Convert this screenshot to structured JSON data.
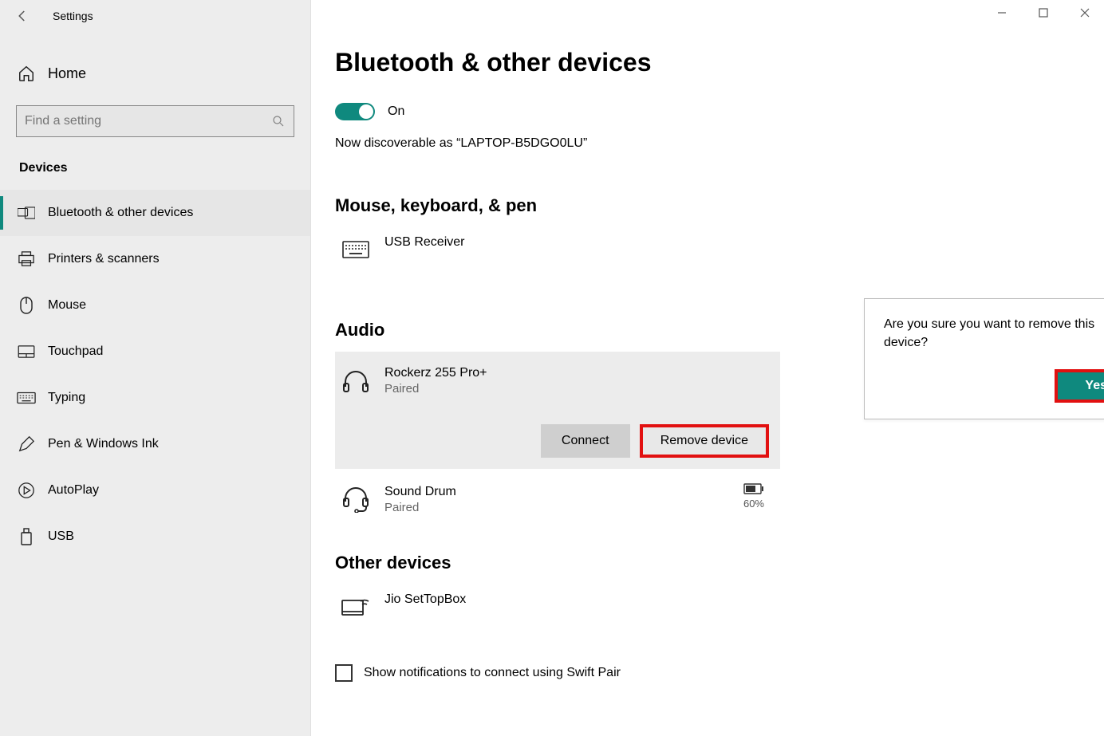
{
  "window": {
    "title": "Settings"
  },
  "sidebar": {
    "home_label": "Home",
    "search_placeholder": "Find a setting",
    "category": "Devices",
    "items": [
      {
        "label": "Bluetooth & other devices"
      },
      {
        "label": "Printers & scanners"
      },
      {
        "label": "Mouse"
      },
      {
        "label": "Touchpad"
      },
      {
        "label": "Typing"
      },
      {
        "label": "Pen & Windows Ink"
      },
      {
        "label": "AutoPlay"
      },
      {
        "label": "USB"
      }
    ]
  },
  "page": {
    "title": "Bluetooth & other devices",
    "toggle_state": "On",
    "discoverable_text": "Now discoverable as “LAPTOP-B5DGO0LU”",
    "sections": {
      "mouse_kb_pen": {
        "title": "Mouse, keyboard, & pen",
        "devices": [
          {
            "name": "USB Receiver"
          }
        ]
      },
      "audio": {
        "title": "Audio",
        "devices": [
          {
            "name": "Rockerz 255 Pro+",
            "status": "Paired",
            "selected": true,
            "buttons": {
              "connect": "Connect",
              "remove": "Remove device"
            }
          },
          {
            "name": "Sound Drum",
            "status": "Paired",
            "battery": "60%"
          }
        ]
      },
      "other": {
        "title": "Other devices",
        "devices": [
          {
            "name": "Jio SetTopBox"
          }
        ]
      }
    },
    "swift_pair_label": "Show notifications to connect using Swift Pair"
  },
  "dialog": {
    "message": "Are you sure you want to remove this device?",
    "confirm_label": "Yes"
  }
}
